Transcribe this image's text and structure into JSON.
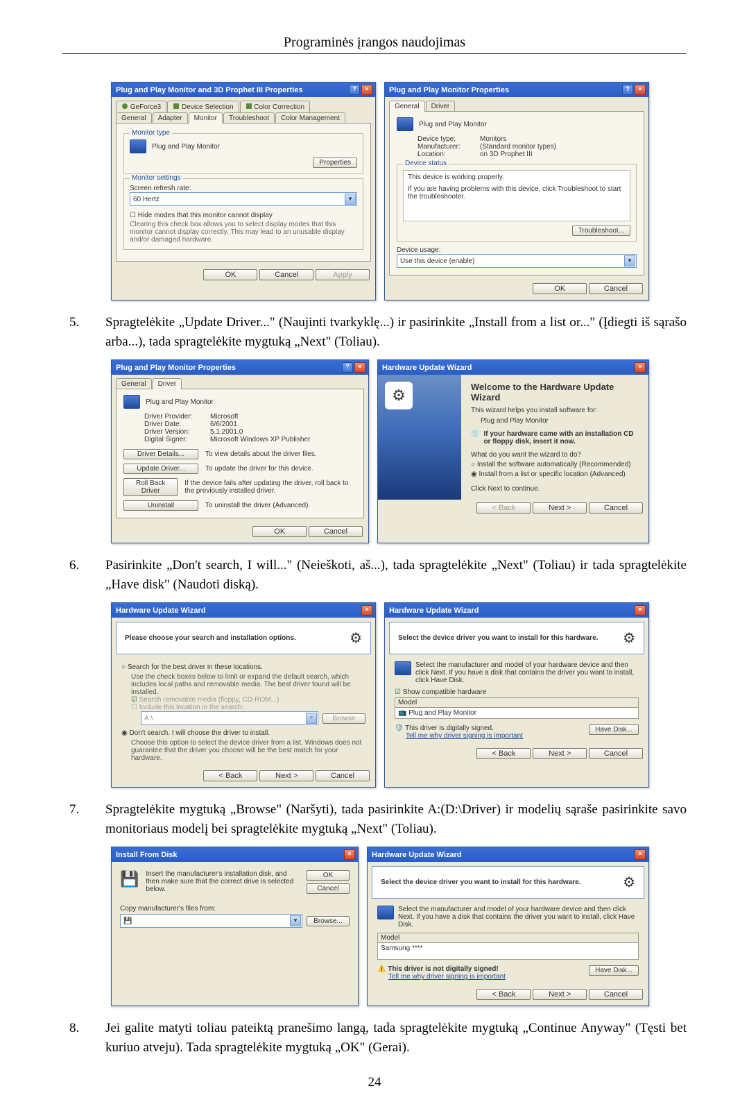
{
  "page": {
    "title": "Programinės įrangos naudojimas",
    "number": "24"
  },
  "steps": {
    "s5": {
      "num": "5.",
      "text": "Spragtelėkite „Update Driver...\" (Naujinti tvarkyklę...) ir pasirinkite „Install from a list or...\" (Įdiegti iš sąrašo arba...), tada spragtelėkite mygtuką „Next\" (Toliau)."
    },
    "s6": {
      "num": "6.",
      "text": "Pasirinkite „Don't search, I will...\" (Neieškoti, aš...), tada spragtelėkite „Next\" (Toliau) ir tada spragtelėkite „Have disk\" (Naudoti diską)."
    },
    "s7": {
      "num": "7.",
      "text": "Spragtelėkite mygtuką „Browse\" (Naršyti), tada pasirinkite A:(D:\\Driver) ir modelių sąraše pasirinkite savo monitoriaus modelį bei spragtelėkite mygtuką „Next\" (Toliau)."
    },
    "s8": {
      "num": "8.",
      "text": "Jei galite matyti toliau pateiktą pranešimo langą, tada spragtelėkite mygtuką „Continue Anyway\" (Tęsti bet kuriuo atveju). Tada spragtelėkite mygtuką „OK\" (Gerai)."
    }
  },
  "common": {
    "ok": "OK",
    "cancel": "Cancel",
    "apply": "Apply",
    "back": "< Back",
    "next": "Next >"
  },
  "row1": {
    "left": {
      "title": "Plug and Play Monitor and 3D Prophet III Properties",
      "tabs": {
        "geforce": "GeForce3",
        "devsel": "Device Selection",
        "colorcorr": "Color Correction",
        "general": "General",
        "adapter": "Adapter",
        "monitor": "Monitor",
        "troubleshoot": "Troubleshoot",
        "colormgmt": "Color Management"
      },
      "montype_lbl": "Monitor type",
      "montype_val": "Plug and Play Monitor",
      "properties_btn": "Properties",
      "monsettings_lbl": "Monitor settings",
      "refresh_lbl": "Screen refresh rate:",
      "refresh_val": "60 Hertz",
      "hide_chk": "Hide modes that this monitor cannot display",
      "hide_note": "Clearing this check box allows you to select display modes that this monitor cannot display correctly. This may lead to an unusable display and/or damaged hardware."
    },
    "right": {
      "title": "Plug and Play Monitor Properties",
      "tabs": {
        "general": "General",
        "driver": "Driver"
      },
      "name": "Plug and Play Monitor",
      "devtype_lbl": "Device type:",
      "devtype_val": "Monitors",
      "manu_lbl": "Manufacturer:",
      "manu_val": "(Standard monitor types)",
      "loc_lbl": "Location:",
      "loc_val": "on 3D Prophet III",
      "status_legend": "Device status",
      "status_line1": "This device is working properly.",
      "status_line2": "If you are having problems with this device, click Troubleshoot to start the troubleshooter.",
      "troubleshoot_btn": "Troubleshoot...",
      "usage_lbl": "Device usage:",
      "usage_val": "Use this device (enable)"
    }
  },
  "row2": {
    "left": {
      "title": "Plug and Play Monitor Properties",
      "tabs": {
        "general": "General",
        "driver": "Driver"
      },
      "name": "Plug and Play Monitor",
      "prov_lbl": "Driver Provider:",
      "prov_val": "Microsoft",
      "date_lbl": "Driver Date:",
      "date_val": "6/6/2001",
      "ver_lbl": "Driver Version:",
      "ver_val": "5.1.2001.0",
      "signer_lbl": "Digital Signer:",
      "signer_val": "Microsoft Windows XP Publisher",
      "btn_details": "Driver Details...",
      "btn_details_desc": "To view details about the driver files.",
      "btn_update": "Update Driver...",
      "btn_update_desc": "To update the driver for this device.",
      "btn_rollback": "Roll Back Driver",
      "btn_rollback_desc": "If the device fails after updating the driver, roll back to the previously installed driver.",
      "btn_uninstall": "Uninstall",
      "btn_uninstall_desc": "To uninstall the driver (Advanced)."
    },
    "right": {
      "title": "Hardware Update Wizard",
      "welcome": "Welcome to the Hardware Update Wizard",
      "line1": "This wizard helps you install software for:",
      "device": "Plug and Play Monitor",
      "cd_note": "If your hardware came with an installation CD or floppy disk, insert it now.",
      "q": "What do you want the wizard to do?",
      "opt1": "Install the software automatically (Recommended)",
      "opt2": "Install from a list or specific location (Advanced)",
      "click_next": "Click Next to continue."
    }
  },
  "row3": {
    "left": {
      "title": "Hardware Update Wizard",
      "header": "Please choose your search and installation options.",
      "opt1": "Search for the best driver in these locations.",
      "opt1_note": "Use the check boxes below to limit or expand the default search, which includes local paths and removable media. The best driver found will be installed.",
      "chk_media": "Search removable media (floppy, CD-ROM...)",
      "chk_loc": "Include this location in the search:",
      "loc_val": "A:\\",
      "browse": "Browse",
      "opt2": "Don't search. I will choose the driver to install.",
      "opt2_note": "Choose this option to select the device driver from a list. Windows does not guarantee that the driver you choose will be the best match for your hardware."
    },
    "right": {
      "title": "Hardware Update Wizard",
      "header": "Select the device driver you want to install for this hardware.",
      "note": "Select the manufacturer and model of your hardware device and then click Next. If you have a disk that contains the driver you want to install, click Have Disk.",
      "chk_compat": "Show compatible hardware",
      "model_lbl": "Model",
      "model_val": "Plug and Play Monitor",
      "signed": "This driver is digitally signed.",
      "tellme": "Tell me why driver signing is important",
      "havedisk": "Have Disk..."
    }
  },
  "row4": {
    "left": {
      "title": "Install From Disk",
      "msg": "Insert the manufacturer's installation disk, and then make sure that the correct drive is selected below.",
      "copy_lbl": "Copy manufacturer's files from:",
      "browse": "Browse..."
    },
    "right": {
      "title": "Hardware Update Wizard",
      "header": "Select the device driver you want to install for this hardware.",
      "note": "Select the manufacturer and model of your hardware device and then click Next. If you have a disk that contains the driver you want to install, click Have Disk.",
      "model_lbl": "Model",
      "model_val": "Samsung ****",
      "unsigned": "This driver is not digitally signed!",
      "tellme": "Tell me why driver signing is important",
      "havedisk": "Have Disk..."
    }
  }
}
